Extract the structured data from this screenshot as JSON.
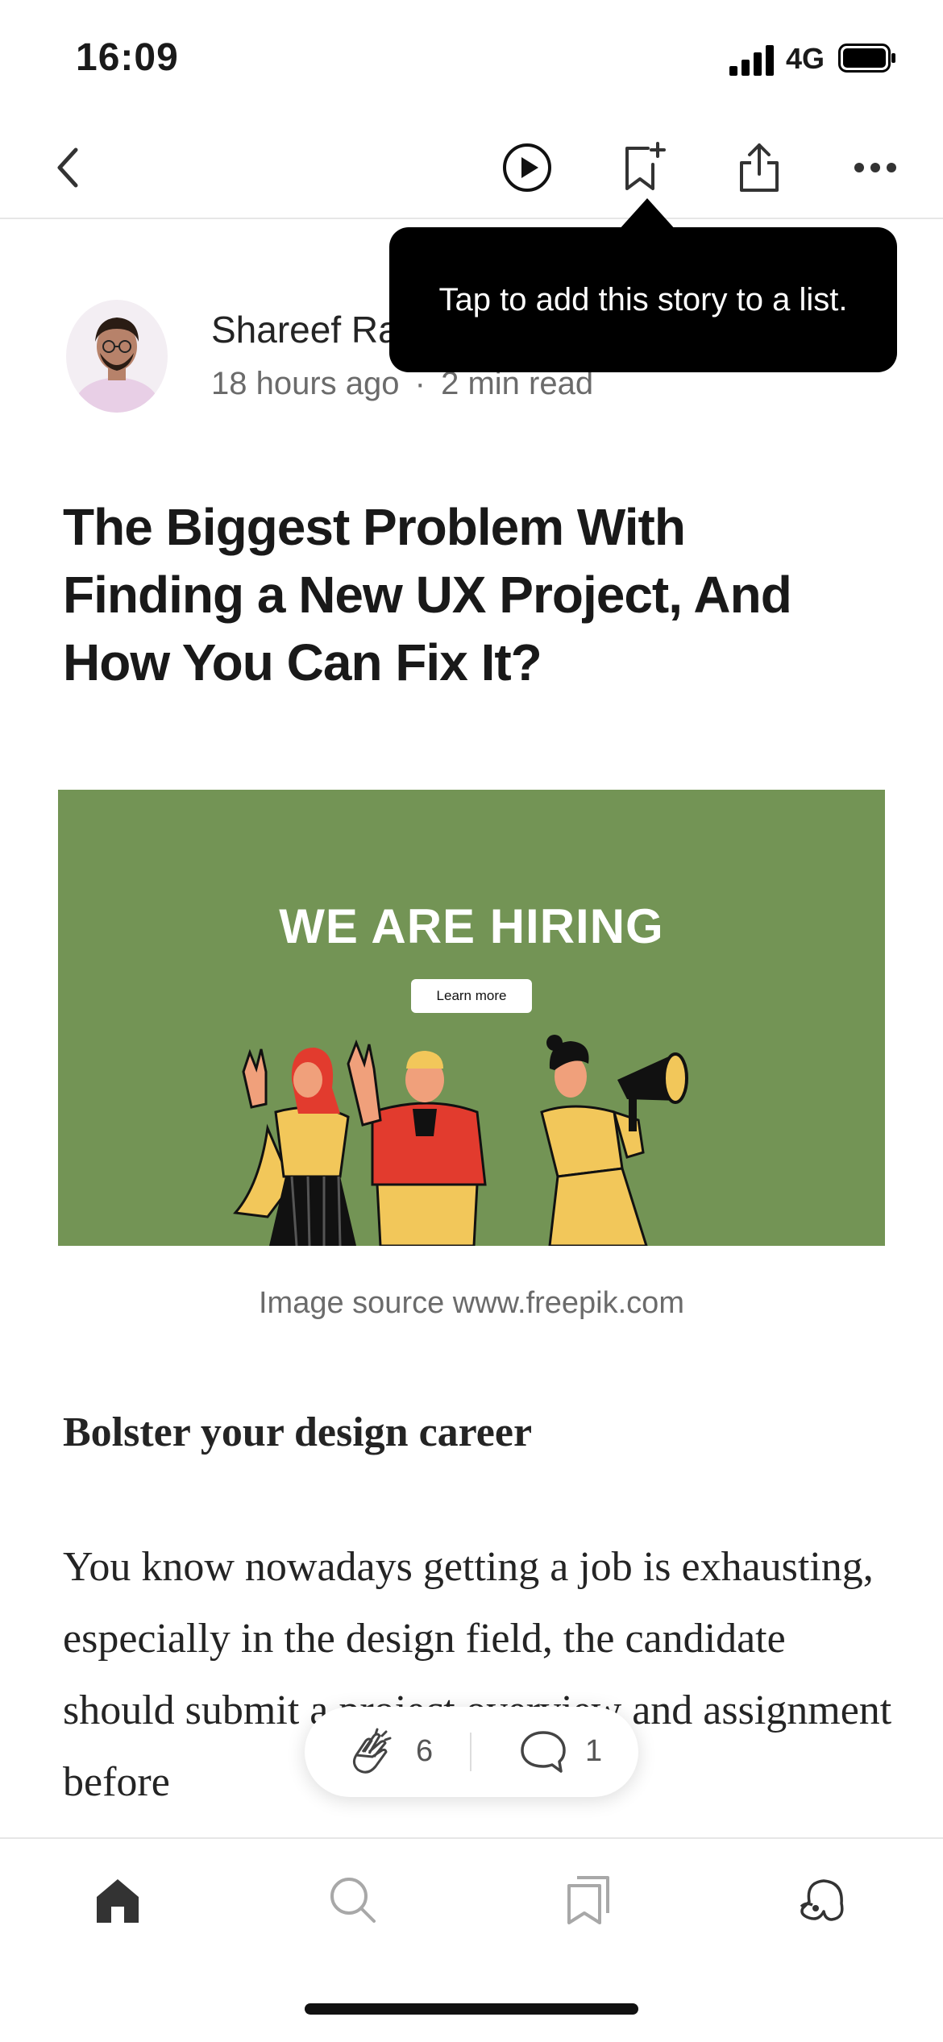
{
  "status_bar": {
    "time": "16:09",
    "network": "4G"
  },
  "toolbar": {
    "back_icon": "chevron-left-icon",
    "listen_icon": "play-circle-icon",
    "save_icon": "bookmark-add-icon",
    "share_icon": "share-icon",
    "more_icon": "more-horizontal-icon"
  },
  "tooltip": {
    "text": "Tap to add this story to a list."
  },
  "author": {
    "name": "Shareef Ra",
    "time_ago": "18 hours ago",
    "separator": "·",
    "read_time": "2 min read"
  },
  "article": {
    "title": "The Biggest Problem With Finding a New UX Project, And How You Can Fix It?",
    "hero": {
      "headline": "WE ARE HIRING",
      "button_label": "Learn more",
      "background": "#739455"
    },
    "caption": "Image source www.freepik.com",
    "subheading": "Bolster your design career",
    "paragraph": "You know nowadays getting a job is exhausting, especially in the design field, the candidate should submit a project overview and assignment before"
  },
  "engagement": {
    "claps": "6",
    "responses": "1"
  },
  "bottom_nav": {
    "items": [
      {
        "name": "home",
        "icon": "home-icon",
        "active": true
      },
      {
        "name": "search",
        "icon": "search-icon",
        "active": false
      },
      {
        "name": "library",
        "icon": "bookmarks-icon",
        "active": false
      },
      {
        "name": "profile",
        "icon": "profile-icon",
        "active": false
      }
    ]
  }
}
